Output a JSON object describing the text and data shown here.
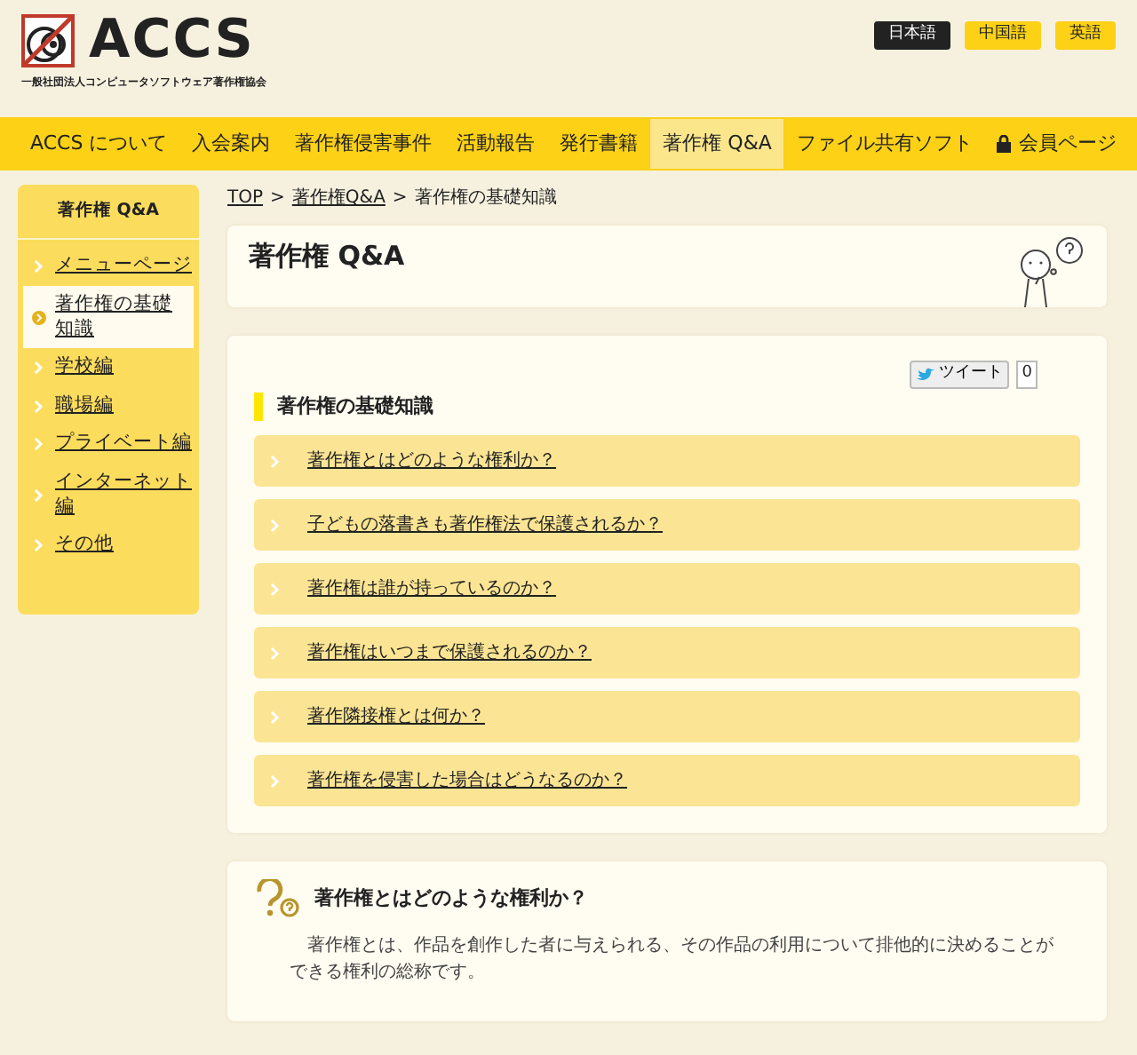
{
  "logo": {
    "name": "ACCS",
    "subtitle": "一般社団法人コンピュータソフトウェア著作権協会"
  },
  "languages": [
    {
      "label": "日本語",
      "selected": true
    },
    {
      "label": "中国語",
      "selected": false
    },
    {
      "label": "英語",
      "selected": false
    }
  ],
  "nav": [
    {
      "label": "ACCS について",
      "selected": false
    },
    {
      "label": "入会案内",
      "selected": false
    },
    {
      "label": "著作権侵害事件",
      "selected": false
    },
    {
      "label": "活動報告",
      "selected": false
    },
    {
      "label": "発行書籍",
      "selected": false
    },
    {
      "label": "著作権 Q&A",
      "selected": true
    },
    {
      "label": "ファイル共有ソフト",
      "selected": false
    }
  ],
  "member_link": "会員ページ",
  "sidebar": {
    "title": "著作権 Q&A",
    "items": [
      {
        "label": "メニューページ",
        "selected": false
      },
      {
        "label": "著作権の基礎知識",
        "selected": true
      },
      {
        "label": "学校編",
        "selected": false
      },
      {
        "label": "職場編",
        "selected": false
      },
      {
        "label": "プライベート編",
        "selected": false
      },
      {
        "label": "インターネット編",
        "selected": false
      },
      {
        "label": "その他",
        "selected": false
      }
    ]
  },
  "breadcrumb": [
    "TOP",
    "著作権Q&A",
    "著作権の基礎知識"
  ],
  "breadcrumb_separator": ">",
  "page_title": "著作権 Q&A",
  "section": {
    "title": "著作権の基礎知識",
    "tweet": "ツイート",
    "tweet_count": "0",
    "questions": [
      "著作権とはどのような権利か？",
      "子どもの落書きも著作権法で保護されるか？",
      "著作権は誰が持っているのか？",
      "著作権はいつまで保護されるのか？",
      "著作隣接権とは何か？",
      "著作権を侵害した場合はどうなるのか？"
    ]
  },
  "answer": {
    "title": "著作権とはどのような権利か？",
    "body": "著作権とは、作品を創作した者に与えられる、その作品の利用について排他的に決めることができる権利の総称です。"
  }
}
